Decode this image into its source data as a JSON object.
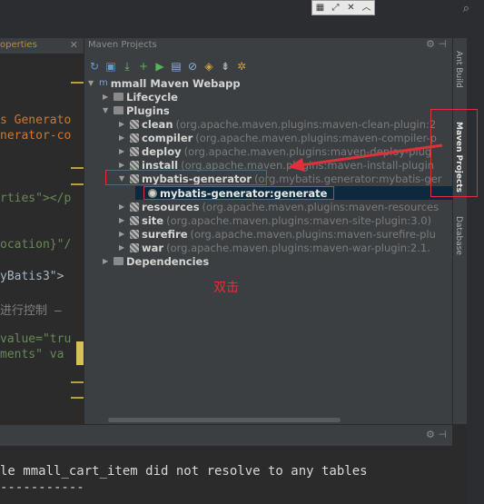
{
  "toolbar_float": [
    "grid",
    "expand",
    "close",
    "collapse"
  ],
  "left_panel": {
    "tab_title": "operties",
    "code_lines": [
      {
        "text": "s Generato",
        "color": "#cc7832"
      },
      {
        "text": "nerator-co",
        "color": "#cc7832"
      },
      {
        "text": "rties\"></p",
        "color": "#6a8759"
      },
      {
        "text": "ocation}\"/",
        "color": "#6a8759"
      },
      {
        "text": "yBatis3\">",
        "color": "#a9b7c6"
      },
      {
        "text": "进行控制 —",
        "color": "#808080"
      },
      {
        "text": "value=\"tru",
        "color": "#6a8759"
      },
      {
        "text": "ments\" va",
        "color": "#6a8759"
      }
    ]
  },
  "maven_panel": {
    "title": "Maven Projects",
    "toolbar_icons": [
      "refresh-icon",
      "generate-sources-icon",
      "download-icon",
      "add-icon",
      "run-icon",
      "toggle-offline-icon",
      "skip-tests-icon",
      "diagram-icon",
      "collapse-all-icon",
      "settings-icon"
    ],
    "tree": {
      "project": "mmall Maven Webapp",
      "lifecycle": "Lifecycle",
      "plugins": "Plugins",
      "plugin_items": [
        {
          "name": "clean",
          "coords": "(org.apache.maven.plugins:maven-clean-plugin:2"
        },
        {
          "name": "compiler",
          "coords": "(org.apache.maven.plugins:maven-compiler-p"
        },
        {
          "name": "deploy",
          "coords": "(org.apache.maven.plugins:maven-deploy-plug"
        },
        {
          "name": "install",
          "coords": "(org.apache.maven.plugins:maven-install-plugin"
        },
        {
          "name": "mybatis-generator",
          "coords": "(org.mybatis.generator:mybatis-ger"
        },
        {
          "name": "resources",
          "coords": "(org.apache.maven.plugins:maven-resources"
        },
        {
          "name": "site",
          "coords": "(org.apache.maven.plugins:maven-site-plugin:3.0)"
        },
        {
          "name": "surefire",
          "coords": "(org.apache.maven.plugins:maven-surefire-plu"
        },
        {
          "name": "war",
          "coords": "(org.apache.maven.plugins:maven-war-plugin:2.1."
        }
      ],
      "goal": "mybatis-generator:generate",
      "dependencies": "Dependencies"
    }
  },
  "right_tabs": {
    "ant_build": "Ant Build",
    "maven_projects": "Maven Projects",
    "database": "Database"
  },
  "annotation": {
    "label": "双击",
    "color": "#e0303a"
  },
  "console": {
    "line1": "le mmall_cart_item did not resolve to any tables",
    "line2": "-----------"
  }
}
